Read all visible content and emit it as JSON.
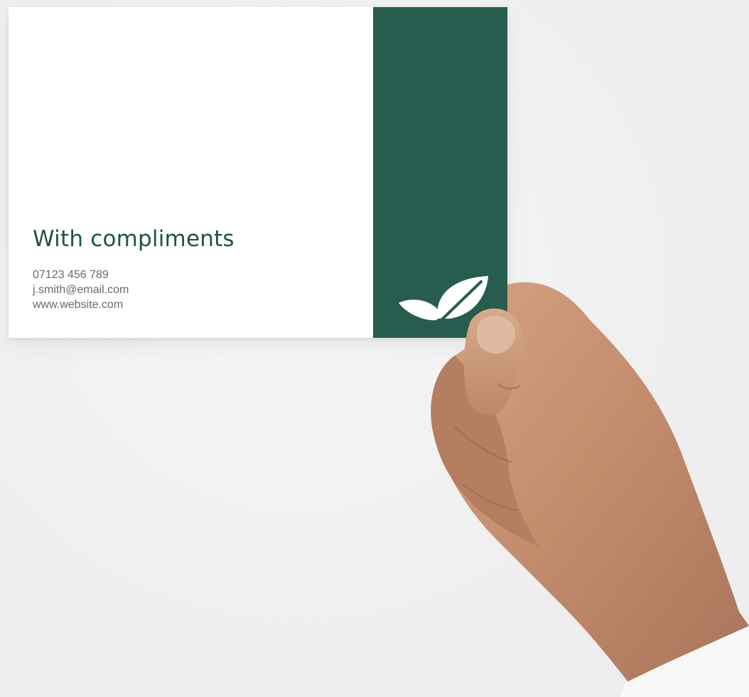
{
  "card": {
    "title": "With compliments",
    "phone": "07123 456 789",
    "email": "j.smith@email.com",
    "website": "www.website.com",
    "logo_icon": "leaf-icon"
  },
  "colors": {
    "background": "#f1f1f1",
    "card": "#ffffff",
    "brand_green": "#285c4e",
    "title_text": "#1f5446",
    "contact_text": "#6a6a6a",
    "skin": "#c99575"
  }
}
